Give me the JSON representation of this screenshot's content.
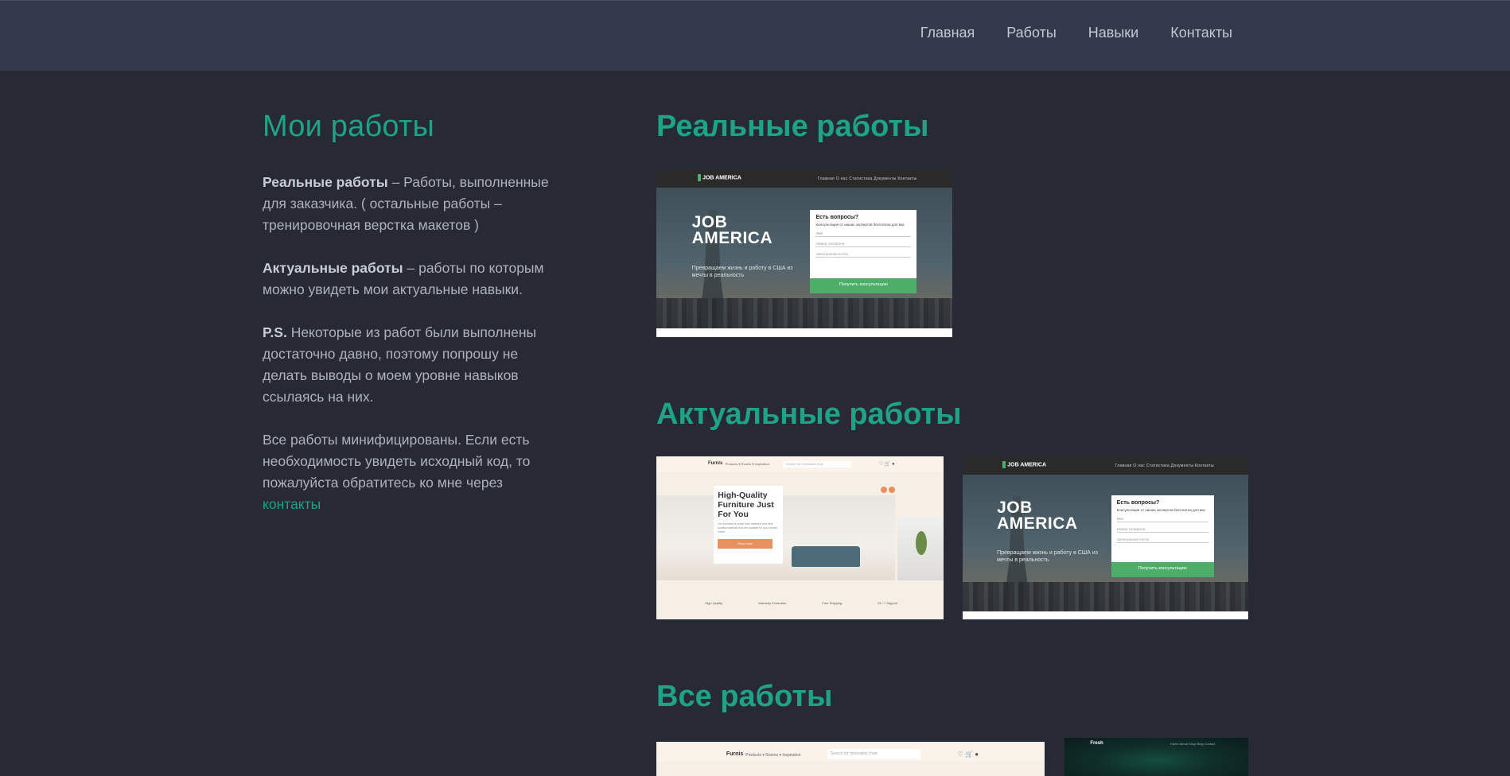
{
  "nav": {
    "items": [
      "Главная",
      "Работы",
      "Навыки",
      "Контакты"
    ]
  },
  "left": {
    "title": "Мои работы",
    "p1_bold": "Реальные работы",
    "p1_text": " – Работы, выполненные для заказчика. ( остальные работы – тренировочная верстка макетов )",
    "p2_bold": "Актуальные работы",
    "p2_text": " – работы по которым можно увидеть мои актуальные навыки.",
    "p3_bold": "P.S.",
    "p3_text": " Некоторые из работ были выполнены достаточно давно, поэтому попрошу не делать выводы о моем уровне навыков ссылаясь на них.",
    "p4_text": "Все работы минифицированы. Если есть необходимость увидеть исходный код, то пожалуйста обратитесь ко мне через ",
    "p4_link": "контакты"
  },
  "sections": {
    "real": "Реальные работы",
    "actual": "Актуальные работы",
    "all": "Все работы"
  },
  "job_america": {
    "logo": "JOB AMERICA",
    "menu": "Главная   О нас   Статистика   Документы   Контакты",
    "title1": "JOB",
    "title2": "AMERICA",
    "subtitle": "Превращаем жизнь и работу в США из мечты в реальность",
    "form_title": "Есть вопросы?",
    "form_text": "Консультация от наших экспертов бесплатна для вас",
    "field1": "Имя",
    "field2": "Номер телефона",
    "field3": "Электронная почта",
    "button": "Получить консультацию"
  },
  "furniture": {
    "brand": "Furnis",
    "menu": "Products ▾   Rooms ▾   Inspiration",
    "search": "Search for minimalist chair",
    "icons": "♡  🛒  ●",
    "hero_title": "High-Quality Furniture Just For You",
    "hero_text": "Our furniture is made from selected and best quality materials that are suitable for your dream home",
    "hero_button": "Shop Now",
    "features": [
      "High Quality",
      "Warranty Protection",
      "Free Shipping",
      "24 / 7 Support"
    ]
  },
  "green_site": {
    "brand": "Fresh",
    "menu": "Home   About   Shop   Blog   Contact"
  }
}
